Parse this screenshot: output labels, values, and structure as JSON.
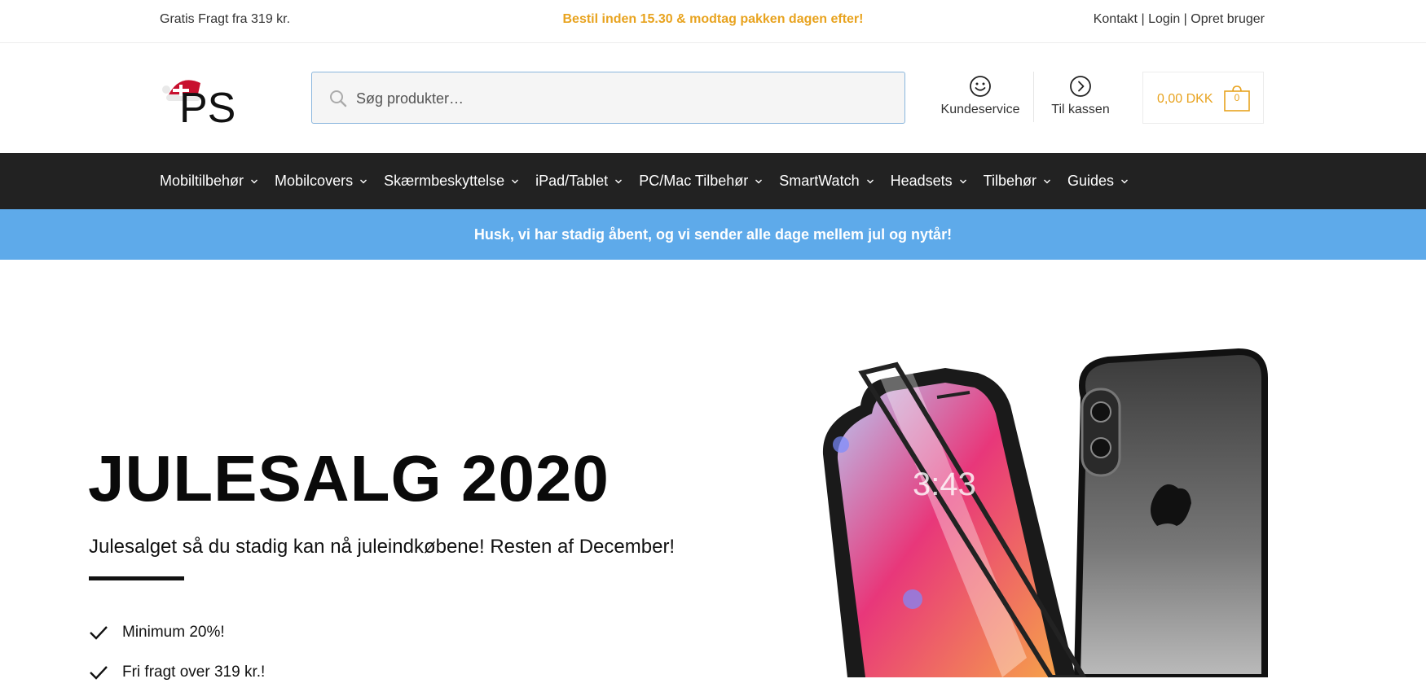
{
  "topbar": {
    "shipping": "Gratis Fragt fra 319 kr.",
    "promo": "Bestil inden 15.30 & modtag pakken dagen efter!",
    "links": {
      "contact": "Kontakt",
      "login": "Login",
      "register": "Opret bruger",
      "separator": "|"
    }
  },
  "header": {
    "logo_text": "PS",
    "search_placeholder": "Søg produkter…",
    "customer_service": "Kundeservice",
    "checkout": "Til kassen",
    "cart_amount": "0,00 DKK",
    "cart_count": "0"
  },
  "nav": {
    "items": [
      {
        "label": "Mobiltilbehør"
      },
      {
        "label": "Mobilcovers"
      },
      {
        "label": "Skærmbeskyttelse"
      },
      {
        "label": "iPad/Tablet"
      },
      {
        "label": "PC/Mac Tilbehør"
      },
      {
        "label": "SmartWatch"
      },
      {
        "label": "Headsets"
      },
      {
        "label": "Tilbehør"
      },
      {
        "label": "Guides"
      }
    ]
  },
  "notice": "Husk, vi har stadig åbent, og vi sender alle dage mellem jul og nytår!",
  "hero": {
    "title": "JULESALG 2020",
    "subtitle": "Julesalget så du stadig kan nå juleindkøbene! Resten af December!",
    "bullets": [
      "Minimum 20%!",
      "Fri fragt over 319 kr.!"
    ]
  },
  "colors": {
    "accent": "#e8a31f",
    "nav_bg": "#222222",
    "notice_bg": "#5eaaea",
    "search_border": "#8ab6dd"
  },
  "icons": [
    "search-icon",
    "smiley-icon",
    "arrow-circle-right-icon",
    "shopping-bag-icon",
    "chevron-down-icon",
    "checkmark-icon"
  ]
}
